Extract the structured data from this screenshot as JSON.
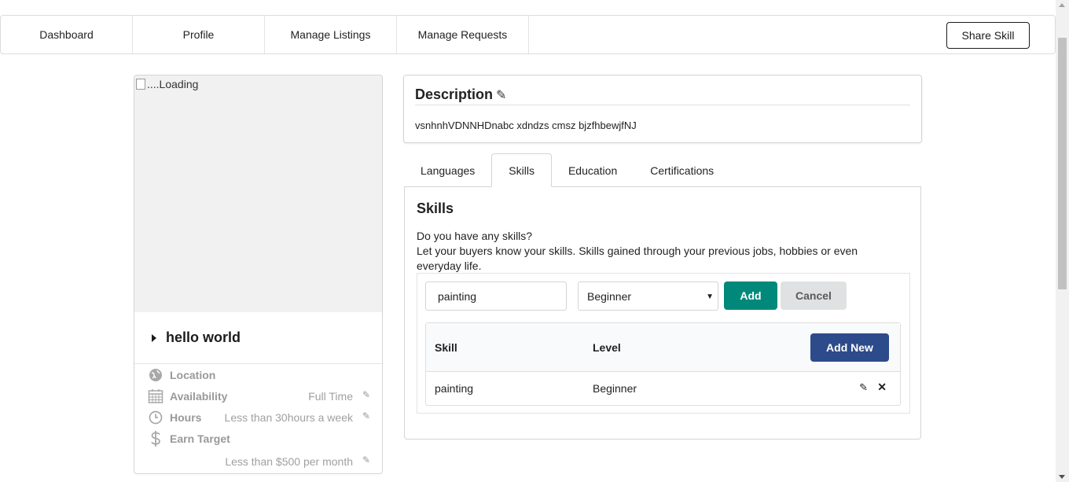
{
  "nav": {
    "items": [
      {
        "label": "Dashboard"
      },
      {
        "label": "Profile"
      },
      {
        "label": "Manage Listings"
      },
      {
        "label": "Manage Requests"
      }
    ],
    "share_label": "Share Skill"
  },
  "profile": {
    "photo_alt": "....Loading",
    "name": "hello world",
    "location_label": "Location",
    "availability_label": "Availability",
    "availability_value": "Full Time",
    "hours_label": "Hours",
    "hours_value": "Less than 30hours a week",
    "earn_label": "Earn Target",
    "earn_value": "Less than $500 per month"
  },
  "description": {
    "title": "Description",
    "text": "vsnhnhVDNNHDnabc xdndzs cmsz bjzfhbewjfNJ"
  },
  "tabs": [
    {
      "label": "Languages"
    },
    {
      "label": "Skills"
    },
    {
      "label": "Education"
    },
    {
      "label": "Certifications"
    }
  ],
  "skills_panel": {
    "title": "Skills",
    "line1": "Do you have any skills?",
    "line2": "Let your buyers know your skills. Skills gained through your previous jobs, hobbies or even everyday life.",
    "input_value": "painting",
    "selected_level": "Beginner",
    "add_label": "Add",
    "cancel_label": "Cancel",
    "table": {
      "col_skill": "Skill",
      "col_level": "Level",
      "add_new_label": "Add New",
      "rows": [
        {
          "skill": "painting",
          "level": "Beginner"
        }
      ]
    }
  },
  "colors": {
    "add_button": "#00897b",
    "add_new_button": "#2d4a8a",
    "cancel_button": "#e0e1e2"
  }
}
